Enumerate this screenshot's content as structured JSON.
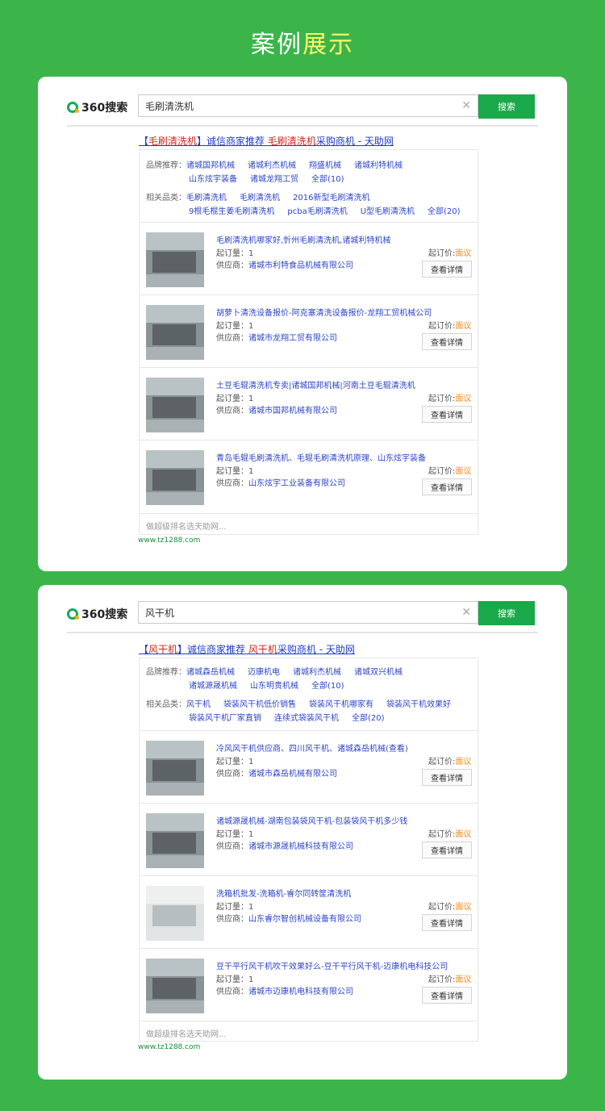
{
  "page_title": {
    "part1": "案例",
    "part2": "展示"
  },
  "cards": [
    {
      "logo": "360搜索",
      "search_value": "毛刷清洗机",
      "search_button": "搜索",
      "ad_title": {
        "b1": "【",
        "k1": "毛刷清洗机",
        "b2": "】诚信商家推荐 ",
        "k2": "毛刷清洗机",
        "b3": "采购商机 - 天助网"
      },
      "brand_label": "品牌推荐：",
      "brands_row1": [
        "诸城国邦机械",
        "诸城利杰机械",
        "翔盛机械",
        "诸城利特机械"
      ],
      "brands_row2": [
        "山东炫宇装备",
        "诸城龙翔工贸",
        "全部(10)"
      ],
      "related_label": "相关品类：",
      "related_row1": [
        "毛刷清洗机",
        "毛刷清洗机",
        "2016新型毛刷清洗机"
      ],
      "related_row2": [
        "9根毛棍生姜毛刷清洗机",
        "pcba毛刷清洗机",
        "U型毛刷清洗机",
        "全部(20)"
      ],
      "products": [
        {
          "title": "毛刷清洗机哪家好,忻州毛刷清洗机,诸城利特机械",
          "moq_label": "起订量：",
          "moq": "1",
          "supplier_label": "供应商：",
          "supplier": "诸城市利特食品机械有限公司",
          "price_label": "起订价:",
          "price": "面议",
          "detail": "查看详情"
        },
        {
          "title": "胡萝卜清洗设备报价-阿克塞清洗设备报价-龙翔工贸机械公司",
          "moq_label": "起订量：",
          "moq": "1",
          "supplier_label": "供应商：",
          "supplier": "诸城市龙翔工贸有限公司",
          "price_label": "起订价:",
          "price": "面议",
          "detail": "查看详情"
        },
        {
          "title": "土豆毛辊清洗机专卖|诸城国邦机械|河南土豆毛辊清洗机",
          "moq_label": "起订量：",
          "moq": "1",
          "supplier_label": "供应商：",
          "supplier": "诸城市国邦机械有限公司",
          "price_label": "起订价:",
          "price": "面议",
          "detail": "查看详情"
        },
        {
          "title": "青岛毛辊毛刷清洗机、毛辊毛刷清洗机原理、山东炫宇装备",
          "moq_label": "起订量：",
          "moq": "1",
          "supplier_label": "供应商：",
          "supplier": "山东炫宇工业装备有限公司",
          "price_label": "起订价:",
          "price": "面议",
          "detail": "查看详情"
        }
      ],
      "footer": "做超级排名选天助网...",
      "site": "www.tz1288.com"
    },
    {
      "logo": "360搜索",
      "search_value": "风干机",
      "search_button": "搜索",
      "ad_title": {
        "b1": "【",
        "k1": "风干机",
        "b2": "】诚信商家推荐 ",
        "k2": "风干机",
        "b3": "采购商机 - 天助网"
      },
      "brand_label": "品牌推荐：",
      "brands_row1": [
        "诸城森岳机械",
        "迈康机电",
        "诸城利杰机械",
        "诸城双兴机械"
      ],
      "brands_row2": [
        "诸城源晟机械",
        "山东明贵机械",
        "全部(10)"
      ],
      "related_label": "相关品类：",
      "related_row1": [
        "风干机",
        "袋装风干机低价销售",
        "袋装风干机哪家有",
        "袋装风干机效果好"
      ],
      "related_row2": [
        "袋装风干机厂家直销",
        "连续式袋装风干机",
        "全部(20)"
      ],
      "products": [
        {
          "title": "冷风风干机供应商、四川风干机、诸城森岳机械(查看)",
          "moq_label": "起订量：",
          "moq": "1",
          "supplier_label": "供应商：",
          "supplier": "诸城市森岳机械有限公司",
          "price_label": "起订价:",
          "price": "面议",
          "detail": "查看详情"
        },
        {
          "title": "诸城源晟机械-湖南包装袋风干机-包装袋风干机多少钱",
          "moq_label": "起订量：",
          "moq": "1",
          "supplier_label": "供应商：",
          "supplier": "诸城市源晟机械科技有限公司",
          "price_label": "起订价:",
          "price": "面议",
          "detail": "查看详情"
        },
        {
          "title": "洗箱机批发-洗箱机-睿尔同转筐清洗机",
          "moq_label": "起订量：",
          "moq": "1",
          "supplier_label": "供应商：",
          "supplier": "山东睿尔智创机械设备有限公司",
          "price_label": "起订价:",
          "price": "面议",
          "detail": "查看详情"
        },
        {
          "title": "豆干平行风干机吹干效果好么-豆干平行风干机-迈康机电科技公司",
          "moq_label": "起订量：",
          "moq": "1",
          "supplier_label": "供应商：",
          "supplier": "诸城市迈康机电科技有限公司",
          "price_label": "起订价:",
          "price": "面议",
          "detail": "查看详情"
        }
      ],
      "footer": "做超级排名选天助网...",
      "site": "www.tz1288.com"
    }
  ]
}
